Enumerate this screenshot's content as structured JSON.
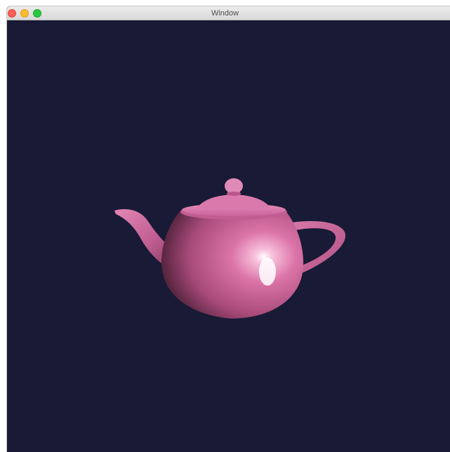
{
  "window": {
    "title": "Window",
    "controls": {
      "close": "close-icon",
      "minimize": "minimize-icon",
      "maximize": "maximize-icon"
    }
  },
  "scene": {
    "object": "teapot",
    "background_color": "#191a35",
    "object_color": "#d66fa3"
  }
}
